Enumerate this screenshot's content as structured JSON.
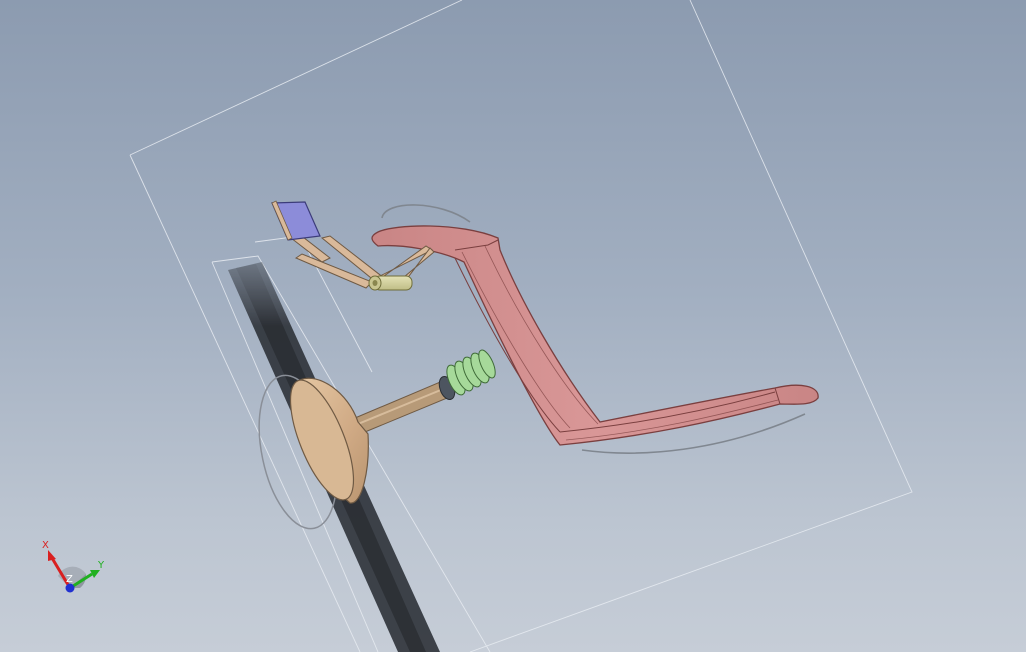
{
  "viewport": {
    "background_top": "#8c9bb0",
    "background_bottom": "#c6cdd7"
  },
  "model": {
    "parts": [
      {
        "name": "valve",
        "color": "#d4b08c"
      },
      {
        "name": "valve-spring",
        "color": "#a6d99a"
      },
      {
        "name": "rocker-arm",
        "color": "#d49090"
      },
      {
        "name": "roller",
        "color": "#d6d4a0"
      },
      {
        "name": "linkage",
        "color": "#d9b99a"
      },
      {
        "name": "pad",
        "color": "#8c8cd9"
      }
    ]
  },
  "triad": {
    "x_label": "X",
    "y_label": "Y",
    "z_label": "Z",
    "x_color": "#d92020",
    "y_color": "#20b020",
    "z_color": "#2030d0"
  }
}
